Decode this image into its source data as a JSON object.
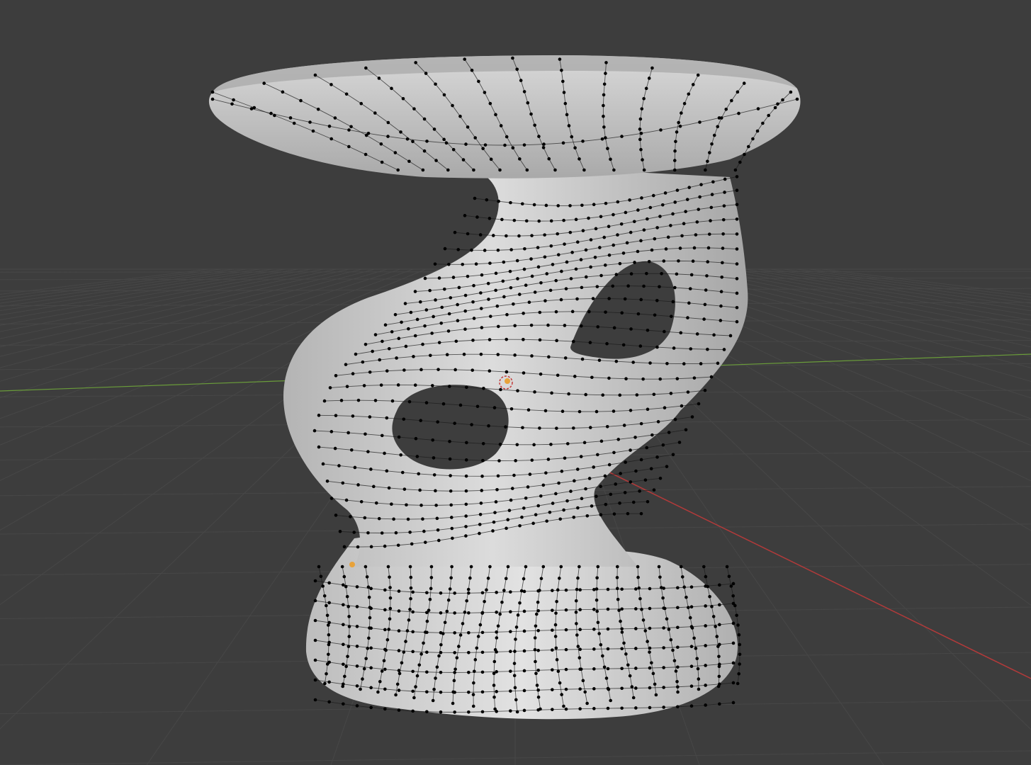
{
  "viewport": {
    "background": "#3d3d3d",
    "grid_color": "#474747",
    "x_axis_color": "#b33a3a",
    "y_axis_color": "#6a9c3a",
    "origin_color": "#e8a23a"
  },
  "object": {
    "mode": "edit",
    "shading": "solid",
    "surface_color": "#c8c8c8",
    "wire_color": "#1a1a1a",
    "vertex_color": "#000000"
  }
}
